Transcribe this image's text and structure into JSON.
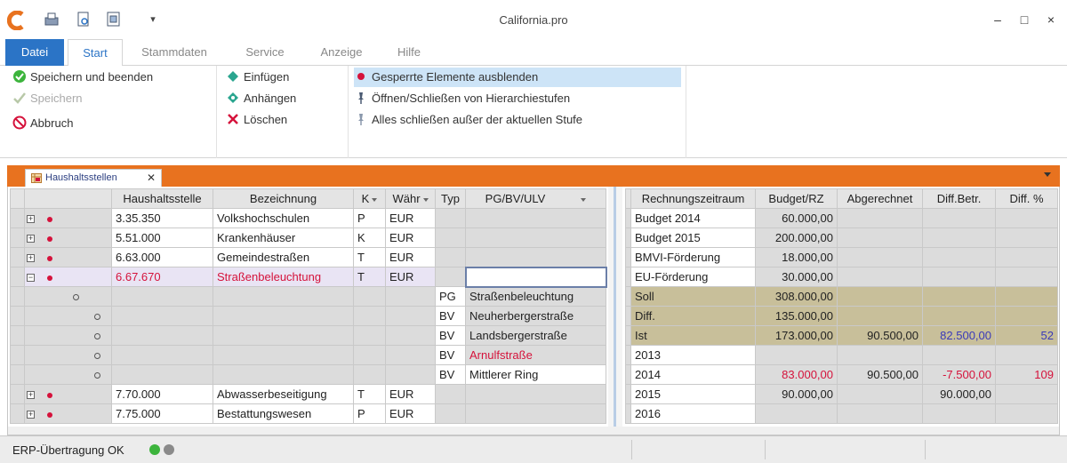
{
  "window": {
    "title": "California.pro",
    "controls": [
      "–",
      "□",
      "×"
    ]
  },
  "ribbon": {
    "tabs": [
      {
        "label": "Datei"
      },
      {
        "label": "Start"
      },
      {
        "label": "Stammdaten"
      },
      {
        "label": "Service"
      },
      {
        "label": "Anzeige"
      },
      {
        "label": "Hilfe"
      }
    ],
    "group1": [
      {
        "label": "Speichern und beenden",
        "icon": "check-circle-icon"
      },
      {
        "label": "Speichern",
        "icon": "check-icon"
      },
      {
        "label": "Abbruch",
        "icon": "no-entry-icon"
      }
    ],
    "group2": [
      {
        "label": "Einfügen",
        "icon": "insert-icon"
      },
      {
        "label": "Anhängen",
        "icon": "append-icon"
      },
      {
        "label": "Löschen",
        "icon": "delete-x-icon"
      }
    ],
    "group3": [
      {
        "label": "Gesperrte Elemente ausblenden",
        "icon": "red-dot-icon"
      },
      {
        "label": "Öffnen/Schließen von Hierarchiestufen",
        "icon": "pin-icon"
      },
      {
        "label": "Alles schließen außer der aktuellen Stufe",
        "icon": "pin-icon"
      }
    ]
  },
  "doc_tab": {
    "label": "Haushaltsstellen",
    "close": "✕"
  },
  "left_grid": {
    "headers": [
      "Haushaltsstelle",
      "Bezeichnung",
      "K",
      "Währ",
      "Typ",
      "PG/BV/ULV"
    ],
    "rows": [
      {
        "expander": "+",
        "dot": true,
        "hst": "3.35.350",
        "bez": "Volkshochschulen",
        "k": "P",
        "waehr": "EUR",
        "typ": "",
        "pg": ""
      },
      {
        "expander": "+",
        "dot": true,
        "hst": "5.51.000",
        "bez": "Krankenhäuser",
        "k": "K",
        "waehr": "EUR",
        "typ": "",
        "pg": ""
      },
      {
        "expander": "+",
        "dot": true,
        "hst": "6.63.000",
        "bez": "Gemeindestraßen",
        "k": "T",
        "waehr": "EUR",
        "typ": "",
        "pg": ""
      },
      {
        "expander": "−",
        "dot": true,
        "hst": "6.67.670",
        "bez": "Straßenbeleuchtung",
        "k": "T",
        "waehr": "EUR",
        "typ": "",
        "pg": ""
      },
      {
        "child": "1",
        "typ": "PG",
        "pg": "Straßenbeleuchtung"
      },
      {
        "child": "2",
        "typ": "BV",
        "pg": "Neuherbergerstraße"
      },
      {
        "child": "2",
        "typ": "BV",
        "pg": "Landsbergerstraße"
      },
      {
        "child": "2",
        "typ": "BV",
        "pg": "Arnulfstraße"
      },
      {
        "child": "2",
        "typ": "BV",
        "pg": "Mittlerer Ring"
      },
      {
        "expander": "+",
        "dot": true,
        "hst": "7.70.000",
        "bez": "Abwasserbeseitigung",
        "k": "T",
        "waehr": "EUR",
        "typ": "",
        "pg": ""
      },
      {
        "expander": "+",
        "dot": true,
        "hst": "7.75.000",
        "bez": "Bestattungswesen",
        "k": "P",
        "waehr": "EUR",
        "typ": "",
        "pg": ""
      }
    ]
  },
  "right_grid": {
    "headers": [
      "Rechnungszeitraum",
      "Budget/RZ",
      "Abgerechnet",
      "Diff.Betr.",
      "Diff. %"
    ],
    "rows": [
      {
        "rz": "Budget 2014",
        "budget": "60.000,00",
        "abg": "",
        "diff": "",
        "pct": ""
      },
      {
        "rz": "Budget 2015",
        "budget": "200.000,00",
        "abg": "",
        "diff": "",
        "pct": ""
      },
      {
        "rz": "BMVI-Förderung",
        "budget": "18.000,00",
        "abg": "",
        "diff": "",
        "pct": ""
      },
      {
        "rz": "EU-Förderung",
        "budget": "30.000,00",
        "abg": "",
        "diff": "",
        "pct": ""
      },
      {
        "rz": "Soll",
        "budget": "308.000,00",
        "abg": "",
        "diff": "",
        "pct": ""
      },
      {
        "rz": "Diff.",
        "budget": "135.000,00",
        "abg": "",
        "diff": "",
        "pct": ""
      },
      {
        "rz": "Ist",
        "budget": "173.000,00",
        "abg": "90.500,00",
        "diff": "82.500,00",
        "pct": "52"
      },
      {
        "rz": "2013",
        "budget": "",
        "abg": "",
        "diff": "",
        "pct": ""
      },
      {
        "rz": "2014",
        "budget": "83.000,00",
        "abg": "90.500,00",
        "diff": "-7.500,00",
        "pct": "109"
      },
      {
        "rz": "2015",
        "budget": "90.000,00",
        "abg": "",
        "diff": "90.000,00",
        "pct": ""
      },
      {
        "rz": "2016",
        "budget": "",
        "abg": "",
        "diff": "",
        "pct": ""
      }
    ]
  },
  "status": {
    "text": "ERP-Übertragung OK",
    "led1": "#3cb43c",
    "led2": "#8a8a8a"
  },
  "colors": {
    "accent": "#2b74c6",
    "strip": "#e8721f",
    "red": "#d5123b",
    "blue": "#3a3ab8",
    "khaki": "#c8bf9a"
  }
}
